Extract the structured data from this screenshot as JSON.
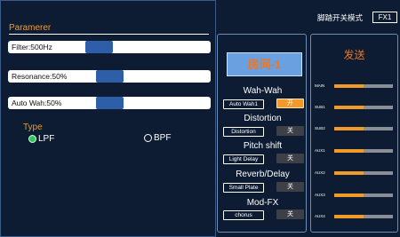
{
  "left_panel": {
    "title": "Paramerer",
    "sliders": [
      {
        "label": "Filter:500Hz",
        "value": 0.45
      },
      {
        "label": "Resonance:50%",
        "value": 0.5
      },
      {
        "label": "Auto Wah:50%",
        "value": 0.5
      }
    ],
    "type_title": "Type",
    "type_options": [
      {
        "label": "LPF",
        "selected": true
      },
      {
        "label": "BPF",
        "selected": false
      }
    ]
  },
  "header": {
    "mode_label": "脚踏开关模式",
    "mode_value": "FX1"
  },
  "fx_panel": {
    "preset_label": "房间-1",
    "effects": [
      {
        "name": "Wah-Wah",
        "select": "Auto Wah1",
        "toggle": "开",
        "on": true
      },
      {
        "name": "Distortion",
        "select": "Distortion",
        "toggle": "关",
        "on": false
      },
      {
        "name": "Pitch shift",
        "select": "Light Delay",
        "toggle": "关",
        "on": false
      },
      {
        "name": "Reverb/Delay",
        "select": "Small Plate",
        "toggle": "关",
        "on": false
      },
      {
        "name": "Mod-FX",
        "select": "chorus",
        "toggle": "关",
        "on": false
      }
    ]
  },
  "send_panel": {
    "title": "发送",
    "sends": [
      {
        "label": "MAIN",
        "value": 0.5
      },
      {
        "label": "SUB1",
        "value": 0.5
      },
      {
        "label": "SUB2",
        "value": 0.5
      },
      {
        "label": "AUX1",
        "value": 0.5
      },
      {
        "label": "AUX2",
        "value": 0.5
      },
      {
        "label": "AUX3",
        "value": 0.5
      },
      {
        "label": "AUX4",
        "value": 0.5
      }
    ]
  },
  "colors": {
    "background": "#0d1c33",
    "accent_orange": "#f09a2a",
    "slider_thumb": "#2f5ea8",
    "preset_button": "#6a9fe0",
    "radio_selected": "#2ec55a"
  }
}
